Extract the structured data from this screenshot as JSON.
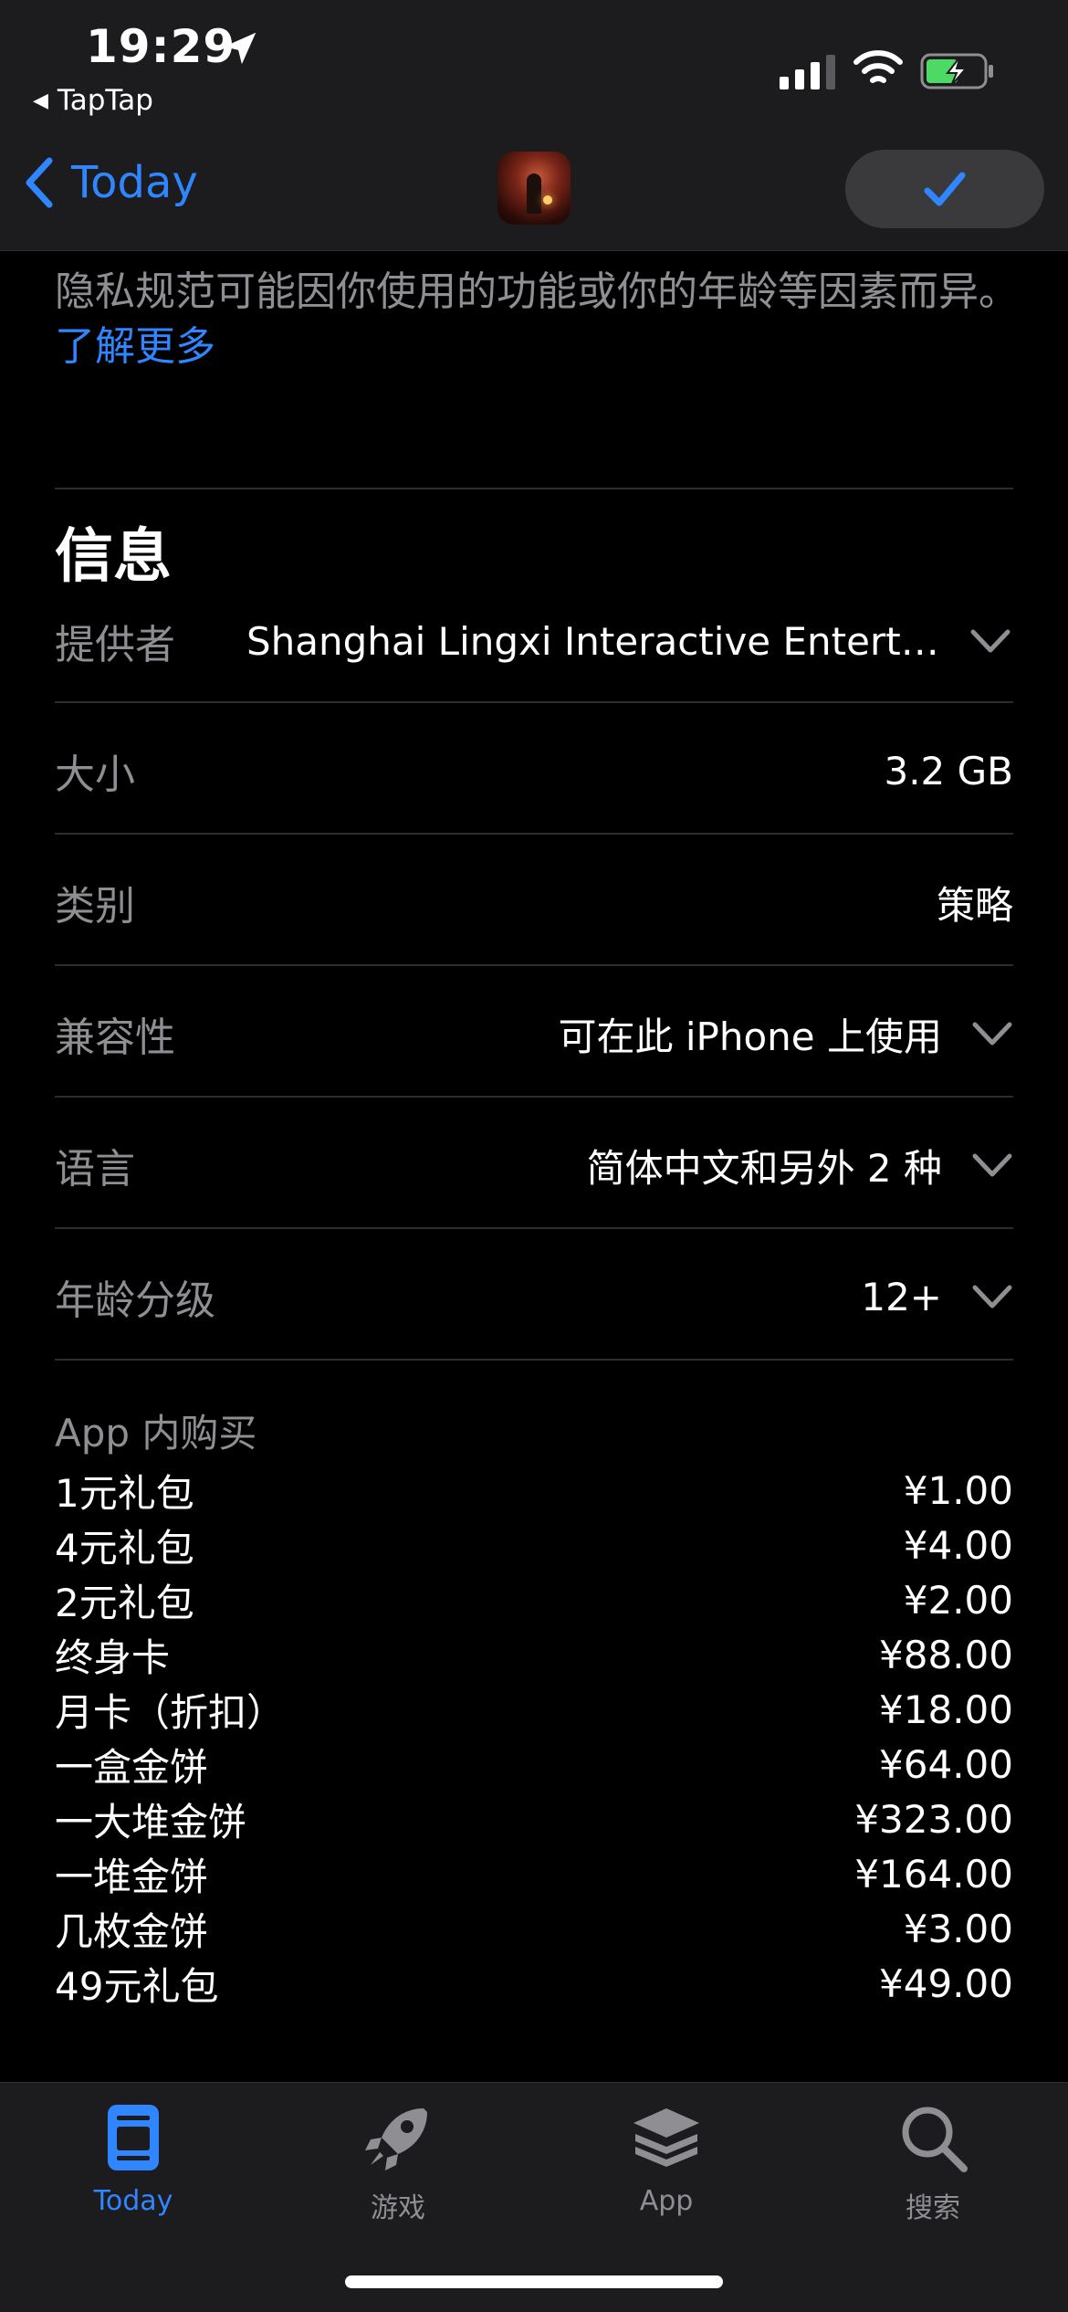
{
  "status": {
    "time": "19:29",
    "back_app": "TapTap"
  },
  "nav": {
    "back_label": "Today"
  },
  "privacy": {
    "text": "隐私规范可能因你使用的功能或你的年龄等因素而异。",
    "link": "了解更多"
  },
  "info": {
    "title": "信息",
    "rows": [
      {
        "key": "提供者",
        "value": "Shanghai Lingxi Interactive Entertai..."
      },
      {
        "key": "大小",
        "value": "3.2 GB"
      },
      {
        "key": "类别",
        "value": "策略"
      },
      {
        "key": "兼容性",
        "value": "可在此 iPhone 上使用"
      },
      {
        "key": "语言",
        "value": "简体中文和另外 2 种"
      },
      {
        "key": "年龄分级",
        "value": "12+"
      }
    ]
  },
  "iap": {
    "title": "App 内购买",
    "items": [
      {
        "name": "1元礼包",
        "price": "¥1.00"
      },
      {
        "name": "4元礼包",
        "price": "¥4.00"
      },
      {
        "name": "2元礼包",
        "price": "¥2.00"
      },
      {
        "name": "终身卡",
        "price": "¥88.00"
      },
      {
        "name": "月卡（折扣）",
        "price": "¥18.00"
      },
      {
        "name": "一盒金饼",
        "price": "¥64.00"
      },
      {
        "name": "一大堆金饼",
        "price": "¥323.00"
      },
      {
        "name": "一堆金饼",
        "price": "¥164.00"
      },
      {
        "name": "几枚金饼",
        "price": "¥3.00"
      },
      {
        "name": "49元礼包",
        "price": "¥49.00"
      }
    ]
  },
  "tabs": [
    {
      "label": "Today",
      "icon": "today-icon",
      "active": true
    },
    {
      "label": "游戏",
      "icon": "rocket-icon",
      "active": false
    },
    {
      "label": "App",
      "icon": "layers-icon",
      "active": false
    },
    {
      "label": "搜索",
      "icon": "search-icon",
      "active": false
    }
  ],
  "colors": {
    "accent": "#2f86ff",
    "background": "#000000",
    "secondary_text": "#8e8e93",
    "battery_fill": "#4cd964"
  }
}
